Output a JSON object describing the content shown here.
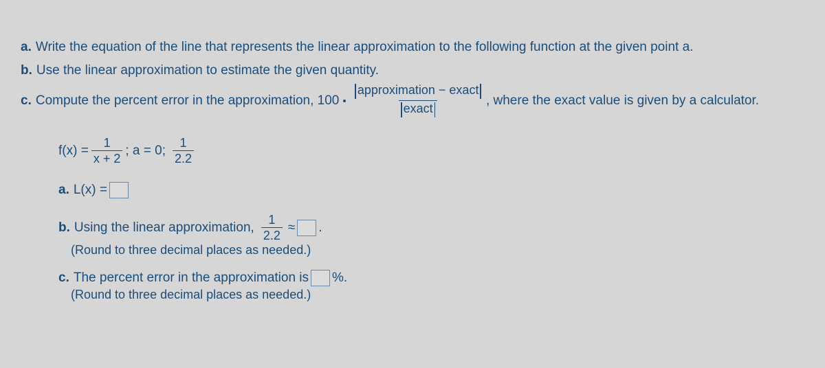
{
  "parts": {
    "a": {
      "label": "a.",
      "text": "Write the equation of the line that represents the linear approximation to the following function at the given point a."
    },
    "b": {
      "label": "b.",
      "text": "Use the linear approximation to estimate the given quantity."
    },
    "c": {
      "label": "c.",
      "prefix": "Compute the percent error in the approximation, 100",
      "frac_num": "approximation − exact",
      "frac_den": "exact",
      "suffix": ", where the exact value is given by a calculator."
    }
  },
  "function": {
    "lhs": "f(x) =",
    "frac1_num": "1",
    "frac1_den": "x + 2",
    "mid": "; a = 0;",
    "frac2_num": "1",
    "frac2_den": "2.2"
  },
  "answers": {
    "a": {
      "label": "a.",
      "text": "L(x) ="
    },
    "b": {
      "label": "b.",
      "prefix": "Using the linear approximation,",
      "frac_num": "1",
      "frac_den": "2.2",
      "approx": "≈",
      "period": ".",
      "hint": "(Round to three decimal places as needed.)"
    },
    "c": {
      "label": "c.",
      "text": "The percent error in the approximation is",
      "unit": "%.",
      "hint": "(Round to three decimal places as needed.)"
    }
  }
}
